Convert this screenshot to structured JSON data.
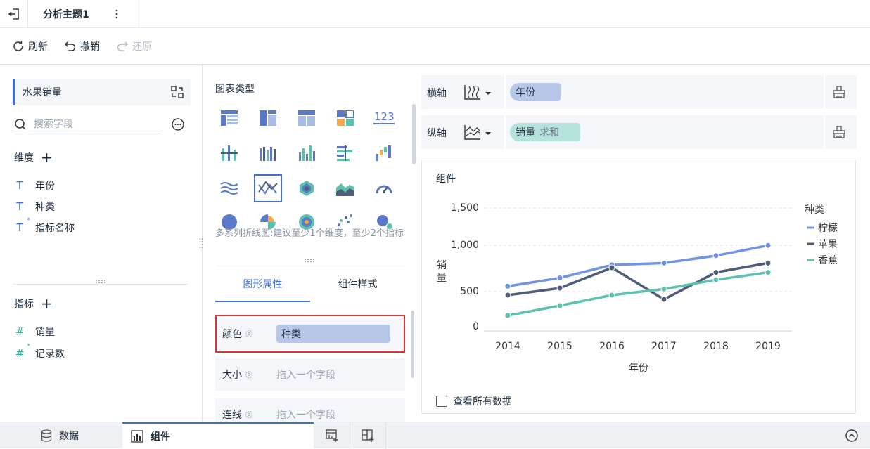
{
  "titlebar": {
    "tab_title": "分析主题1"
  },
  "toolbar": {
    "refresh": "刷新",
    "undo": "撤销",
    "redo": "还原"
  },
  "left": {
    "dataset": "水果销量",
    "search_placeholder": "搜索字段",
    "dimensions_label": "维度",
    "dimensions": [
      "年份",
      "种类",
      "指标名称"
    ],
    "metrics_label": "指标",
    "metrics": [
      "销量",
      "记录数"
    ]
  },
  "middle": {
    "chart_type_label": "图表类型",
    "hint": "多系列折线图:建议至少1个维度，至少2个指标",
    "tabs": [
      "图形属性",
      "组件样式"
    ],
    "props": [
      {
        "label": "颜色",
        "value": "种类"
      },
      {
        "label": "大小",
        "placeholder": "拖入一个字段"
      },
      {
        "label": "连线",
        "placeholder": "拖入一个字段"
      }
    ]
  },
  "axes": {
    "x_label": "横轴",
    "x_field": "年份",
    "y_label": "纵轴",
    "y_field": "销量",
    "y_agg": "求和"
  },
  "component": {
    "title": "组件",
    "show_all": "查看所有数据"
  },
  "chart_data": {
    "type": "line",
    "xlabel": "年份",
    "ylabel": "销量",
    "categories": [
      "2014",
      "2015",
      "2016",
      "2017",
      "2018",
      "2019"
    ],
    "y_ticks": [
      "1,500",
      "1,000",
      "500",
      "0"
    ],
    "legend_title": "种类",
    "legend_position": "right",
    "series": [
      {
        "name": "柠檬",
        "color": "#7393e3",
        "values": [
          550,
          640,
          780,
          800,
          880,
          990
        ]
      },
      {
        "name": "苹果",
        "color": "#4f5d78",
        "values": [
          440,
          530,
          750,
          380,
          700,
          800
        ]
      },
      {
        "name": "香蕉",
        "color": "#5ec0ae",
        "values": [
          150,
          290,
          440,
          520,
          620,
          700
        ]
      }
    ]
  },
  "bottom": {
    "data_tab": "数据",
    "component_tab": "组件"
  }
}
